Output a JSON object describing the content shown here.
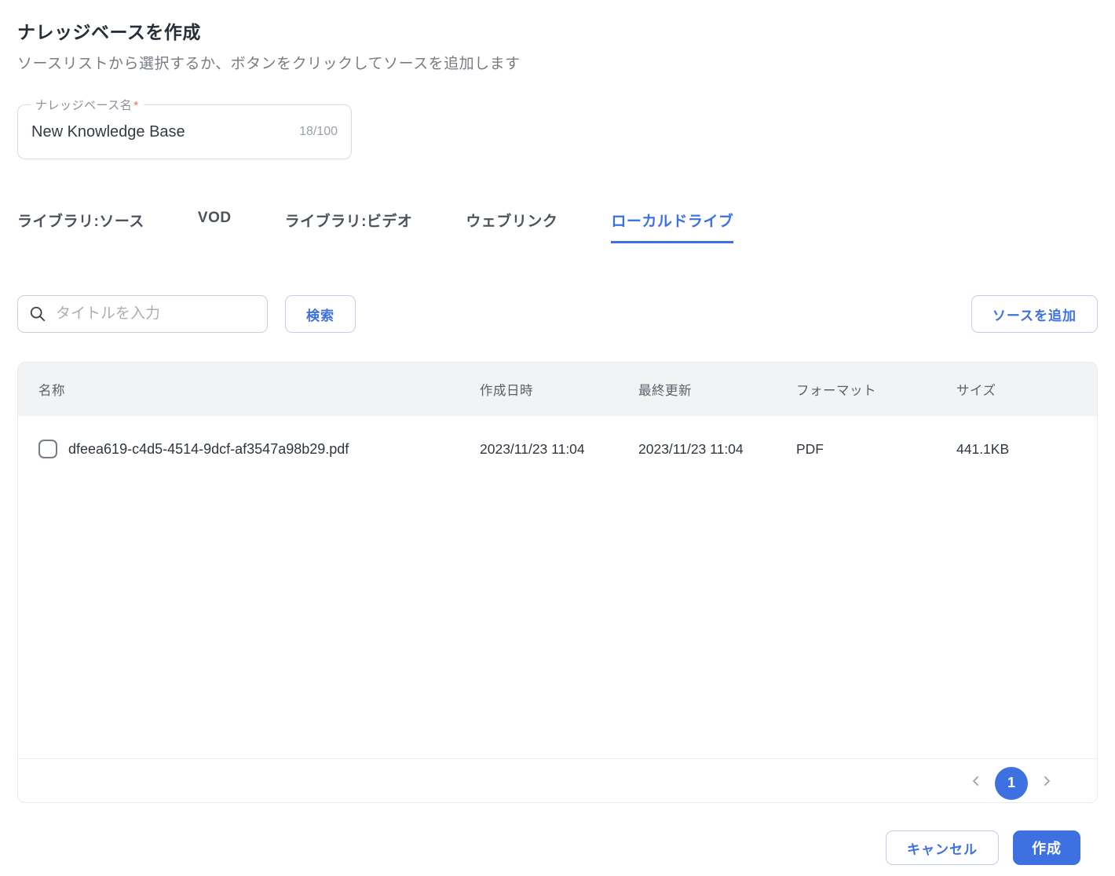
{
  "header": {
    "title": "ナレッジベースを作成",
    "subtitle": "ソースリストから選択するか、ボタンをクリックしてソースを追加します"
  },
  "name_field": {
    "label": "ナレッジベース名",
    "required_mark": "*",
    "value": "New Knowledge Base",
    "counter": "18/100"
  },
  "tabs": [
    {
      "label": "ライブラリ:ソース",
      "active": false
    },
    {
      "label": "VOD",
      "active": false
    },
    {
      "label": "ライブラリ:ビデオ",
      "active": false
    },
    {
      "label": "ウェブリンク",
      "active": false
    },
    {
      "label": "ローカルドライブ",
      "active": true
    }
  ],
  "toolbar": {
    "search_placeholder": "タイトルを入力",
    "search_button_label": "検索",
    "add_source_button_label": "ソースを追加"
  },
  "table": {
    "headers": {
      "name": "名称",
      "created_at": "作成日時",
      "updated_at": "最終更新",
      "format": "フォーマット",
      "size": "サイズ"
    },
    "rows": [
      {
        "checked": false,
        "name": "dfeea619-c4d5-4514-9dcf-af3547a98b29.pdf",
        "created_at": "2023/11/23 11:04",
        "updated_at": "2023/11/23 11:04",
        "format": "PDF",
        "size": "441.1KB"
      }
    ]
  },
  "pagination": {
    "current_page": "1"
  },
  "actions": {
    "cancel_label": "キャンセル",
    "create_label": "作成"
  },
  "icons": {
    "search_icon": "magnifier",
    "chevron_left_icon": "‹",
    "chevron_right_icon": "›",
    "checkbox_icon": "unchecked-rounded-square"
  },
  "colors": {
    "accent": "#3D70E1",
    "accent_border": "#BDCFF3",
    "required_asterisk": "#E96C4C",
    "table_header_bg": "#F2F3F5",
    "text_primary": "#262E38",
    "text_secondary": "#767D85"
  }
}
